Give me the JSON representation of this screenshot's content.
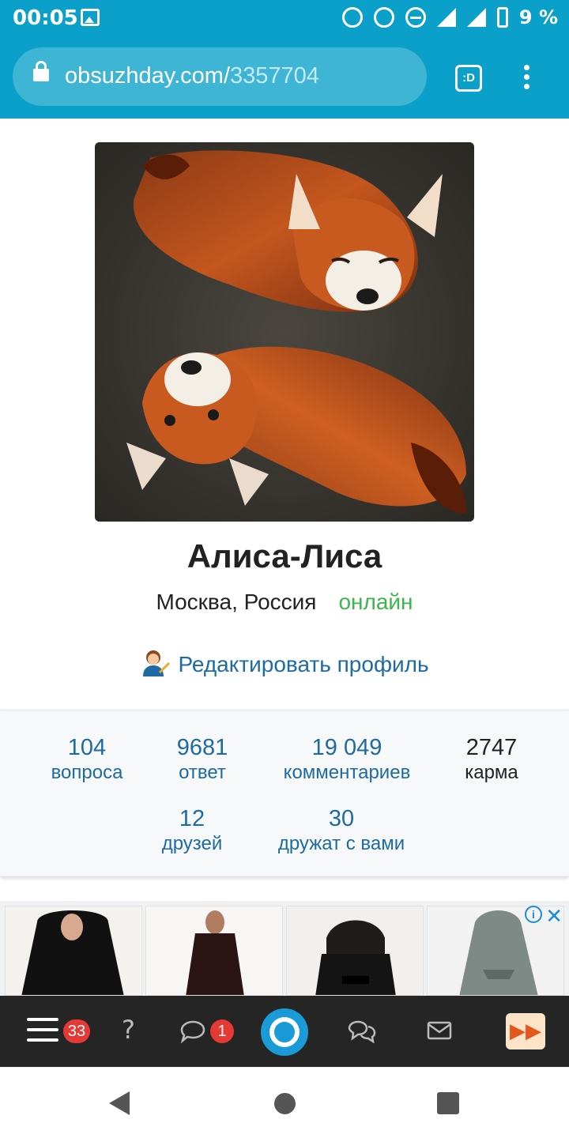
{
  "status_bar": {
    "time": "00:05",
    "battery": "9 %"
  },
  "browser": {
    "url_host": "obsuzhday.com/",
    "url_path": "3357704",
    "tab_button": ":D"
  },
  "profile": {
    "name": "Алиса-Лиса",
    "location": "Москва, Россия",
    "status": "онлайн",
    "edit_label": "Редактировать профиль"
  },
  "stats": {
    "questions": {
      "value": "104",
      "label": "вопроса"
    },
    "answers": {
      "value": "9681",
      "label": "ответ"
    },
    "comments": {
      "value": "19 049",
      "label": "комментариев"
    },
    "karma": {
      "value": "2747",
      "label": "карма"
    },
    "friends": {
      "value": "12",
      "label": "друзей"
    },
    "followers": {
      "value": "30",
      "label": "дружат с вами"
    }
  },
  "ads": {
    "info": "i",
    "close": "✕"
  },
  "site_nav": {
    "menu_badge": "33",
    "messages_badge": "1",
    "question_icon": "?",
    "fast_forward": "▶▶"
  },
  "colors": {
    "brand": "#0aa0c9",
    "link": "#1e6aa3",
    "online": "#3db54a",
    "badge": "#e53935"
  },
  "icons": [
    "lock-icon",
    "alarm-icon",
    "mute-icon",
    "dnd-icon",
    "signal-icon",
    "battery-icon",
    "gallery-icon",
    "edit-profile-icon",
    "help-icon",
    "comment-icon",
    "chat-icon",
    "mail-icon",
    "logo-icon",
    "fast-forward-icon",
    "back-icon",
    "home-icon",
    "recent-icon"
  ]
}
